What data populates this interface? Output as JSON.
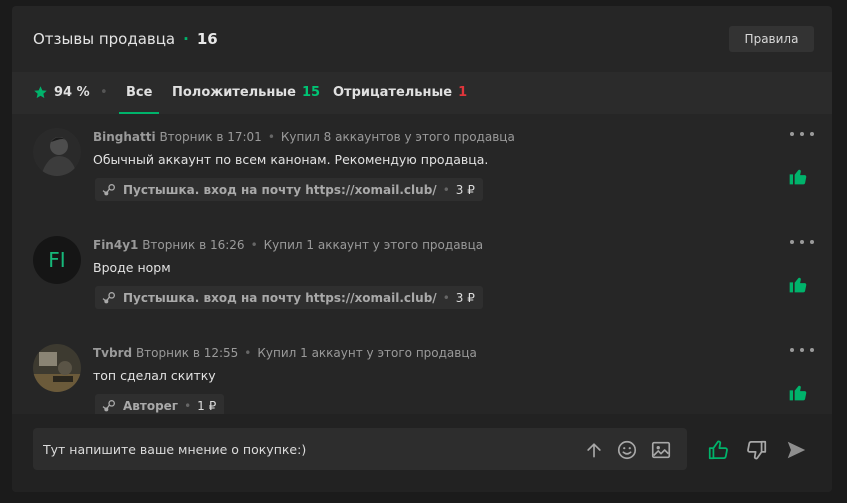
{
  "header": {
    "title": "Отзывы продавца",
    "separator": "·",
    "count": "16",
    "rules_button": "Правила"
  },
  "tabs": {
    "rating": "94 %",
    "separator": "•",
    "all": "Все",
    "positive_label": "Положительные",
    "positive_count": "15",
    "negative_label": "Отрицательные",
    "negative_count": "1"
  },
  "reviews": [
    {
      "user": "Binghatti",
      "time": "Вторник в 17:01",
      "purchase": "Купил 8 аккаунтов у этого продавца",
      "text": "Обычный аккаунт по всем канонам. Рекомендую продавца.",
      "product": "Пустышка. вход на почту https://xomail.club/",
      "price": "3 ₽",
      "avatar_initials": ""
    },
    {
      "user": "Fin4y1",
      "time": "Вторник в 16:26",
      "purchase": "Купил 1 аккаунт у этого продавца",
      "text": "Вроде норм",
      "product": "Пустышка. вход на почту https://xomail.club/",
      "price": "3 ₽",
      "avatar_initials": "FI"
    },
    {
      "user": "Tvbrd",
      "time": "Вторник в 12:55",
      "purchase": "Купил 1 аккаунт у этого продавца",
      "text": "топ сделал скитку",
      "product": "Авторег",
      "price": "1 ₽",
      "avatar_initials": ""
    }
  ],
  "composer": {
    "placeholder": "Тут напишите ваше мнение о покупке:)"
  },
  "icons": {
    "star": "star-icon",
    "steam": "steam-icon",
    "more": "more-options-icon",
    "thumbs_up": "thumbs-up-icon",
    "thumbs_down": "thumbs-down-icon",
    "upload": "arrow-up-icon",
    "emoji": "emoji-icon",
    "image": "image-icon",
    "send": "send-icon"
  },
  "colors": {
    "accent": "#00b36b",
    "negative": "#e0353b",
    "panel": "#262626",
    "background": "#1b1b1b"
  }
}
